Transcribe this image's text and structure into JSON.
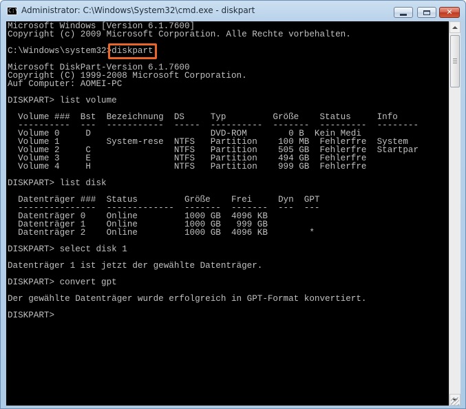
{
  "window": {
    "title": "Administrator: C:\\Windows\\System32\\cmd.exe - diskpart",
    "app_icon_label": "C:\\",
    "icons": [
      "cmd-app-icon",
      "minimize-icon",
      "maximize-icon",
      "close-icon"
    ]
  },
  "console": {
    "lines": [
      "Microsoft Windows [Version 6.1.7600]",
      "Copyright (c) 2009 Microsoft Corporation. Alle Rechte vorbehalten.",
      "",
      "C:\\Windows\\system32>diskpart",
      "",
      "Microsoft DiskPart-Version 6.1.7600",
      "Copyright (C) 1999-2008 Microsoft Corporation.",
      "Auf Computer: AOMEI-PC",
      "",
      "DISKPART> list volume",
      "",
      "  Volume ###  Bst  Bezeichnung  DS     Typ         Größe    Status     Info",
      "  ----------  ---  -----------  -----  ----------  -------  ---------  --------",
      "  Volume 0     D                       DVD-ROM        0 B  Kein Medi",
      "  Volume 1         System-rese  NTFS   Partition    100 MB  Fehlerfre  System",
      "  Volume 2     C                NTFS   Partition    505 GB  Fehlerfre  Startpar",
      "  Volume 3     E                NTFS   Partition    494 GB  Fehlerfre",
      "  Volume 4     H                NTFS   Partition    999 GB  Fehlerfre",
      "",
      "DISKPART> list disk",
      "",
      "  Datenträger ###  Status         Größe    Frei     Dyn  GPT",
      "  ---------------  -------------  -------  -------  ---  ---",
      "  Datenträger 0    Online         1000 GB  4096 KB",
      "  Datenträger 1    Online         1000 GB   999 GB",
      "  Datenträger 2    Online         1000 GB  4096 KB        *",
      "",
      "DISKPART> select disk 1",
      "",
      "Datenträger 1 ist jetzt der gewählte Datenträger.",
      "",
      "DISKPART> convert gpt",
      "",
      "Der gewählte Datenträger wurde erfolgreich in GPT-Format konvertiert.",
      "",
      "DISKPART>"
    ]
  },
  "highlights": [
    "diskpart",
    "list volume",
    "list disk",
    "select disk 1",
    "convert gpt"
  ],
  "colors": {
    "console_bg": "#000000",
    "console_text": "#c0c0c0",
    "highlight_border": "#e8662a"
  }
}
